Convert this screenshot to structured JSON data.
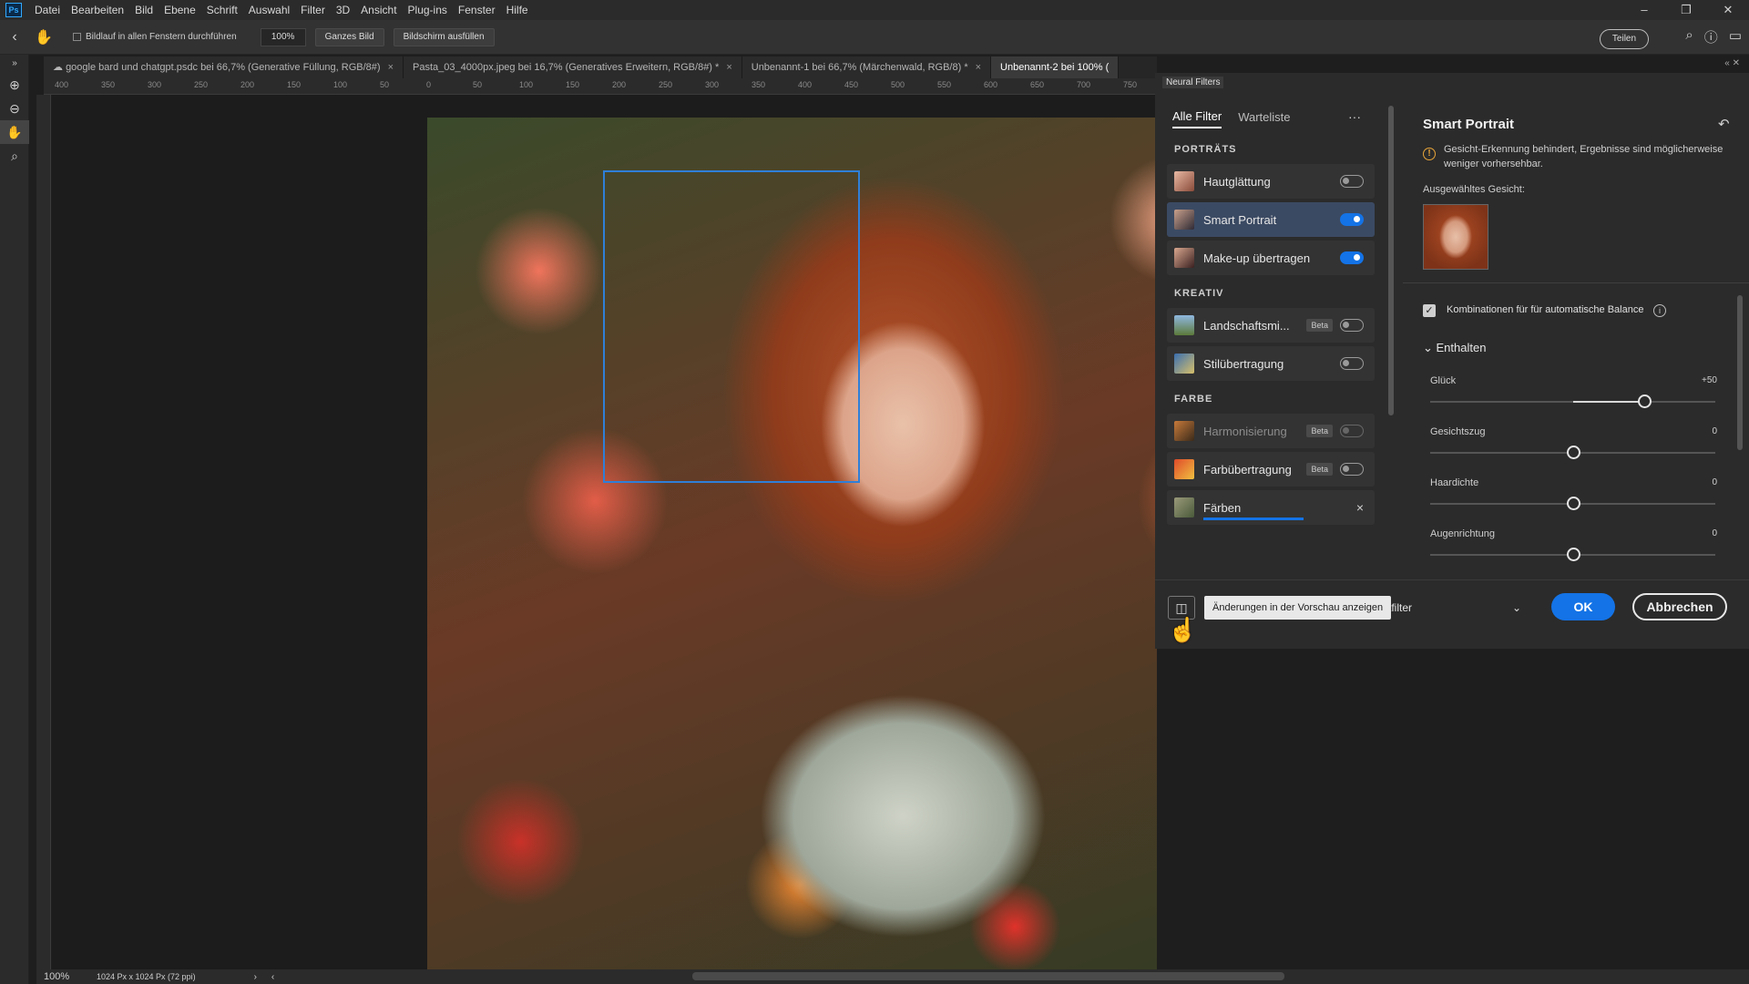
{
  "app": {
    "logo": "Ps",
    "menu": [
      "Datei",
      "Bearbeiten",
      "Bild",
      "Ebene",
      "Schrift",
      "Auswahl",
      "Filter",
      "3D",
      "Ansicht",
      "Plug-ins",
      "Fenster",
      "Hilfe"
    ]
  },
  "options_bar": {
    "scroll_all_label": "Bildlauf in allen Fenstern durchführen",
    "zoom_value": "100%",
    "fit_label": "Ganzes Bild",
    "fill_label": "Bildschirm ausfüllen",
    "share_label": "Teilen"
  },
  "tabs": [
    {
      "label": "google bard und chatgpt.psdc bei 66,7% (Generative Füllung, RGB/8#)",
      "close": "×"
    },
    {
      "label": "Pasta_03_4000px.jpeg bei 16,7% (Generatives Erweitern, RGB/8#) *",
      "close": "×"
    },
    {
      "label": "Unbenannt-1 bei 66,7% (Märchenwald, RGB/8) *",
      "close": "×"
    },
    {
      "label": "Unbenannt-2 bei 100% (",
      "close": ""
    }
  ],
  "ruler_top": [
    "400",
    "350",
    "300",
    "250",
    "200",
    "150",
    "100",
    "50",
    "0",
    "50",
    "100",
    "150",
    "200",
    "250",
    "300",
    "350",
    "400",
    "450",
    "500",
    "550",
    "600",
    "650",
    "700",
    "750"
  ],
  "neural_filters": {
    "panel_title": "Neural Filters",
    "tabs": [
      "Alle Filter",
      "Warteliste"
    ],
    "more": "···",
    "categories": [
      {
        "title": "PORTRÄTS",
        "items": [
          {
            "name": "Hautglättung",
            "state": "off"
          },
          {
            "name": "Smart Portrait",
            "state": "on"
          },
          {
            "name": "Make-up übertragen",
            "state": "on"
          }
        ]
      },
      {
        "title": "KREATIV",
        "items": [
          {
            "name": "Landschaftsmi...",
            "badge": "Beta",
            "state": "off"
          },
          {
            "name": "Stilübertragung",
            "state": "off"
          }
        ]
      },
      {
        "title": "FARBE",
        "items": [
          {
            "name": "Harmonisierung",
            "badge": "Beta",
            "state": "off"
          },
          {
            "name": "Farbübertragung",
            "badge": "Beta",
            "state": "off"
          },
          {
            "name": "Färben",
            "state": "downloading",
            "close": "×"
          }
        ]
      }
    ],
    "settings": {
      "title": "Smart Portrait",
      "warning": "Gesicht-Erkennung behindert, Ergebnisse sind möglicherweise weniger vorhersehbar.",
      "selected_face_label": "Ausgewähltes Gesicht:",
      "combo_label": "Kombinationen für für automatische Balance",
      "section": "Enthalten",
      "sliders": [
        {
          "label": "Glück",
          "value": "+50",
          "level": 50
        },
        {
          "label": "Gesichtszug",
          "value": "0",
          "level": 0
        },
        {
          "label": "Haardichte",
          "value": "0",
          "level": 0
        },
        {
          "label": "Augenrichtung",
          "value": "0",
          "level": 0
        }
      ]
    },
    "footer": {
      "tooltip": "Änderungen in der Vorschau anzeigen",
      "output_partial": "rtfilter",
      "ok": "OK",
      "cancel": "Abbrechen"
    }
  },
  "status": {
    "zoom": "100%",
    "doc_info": "1024 Px x 1024 Px (72 ppi)"
  },
  "colors": {
    "accent": "#1473e6",
    "face_box": "#2f7fd8",
    "warning": "#e8a53a"
  }
}
